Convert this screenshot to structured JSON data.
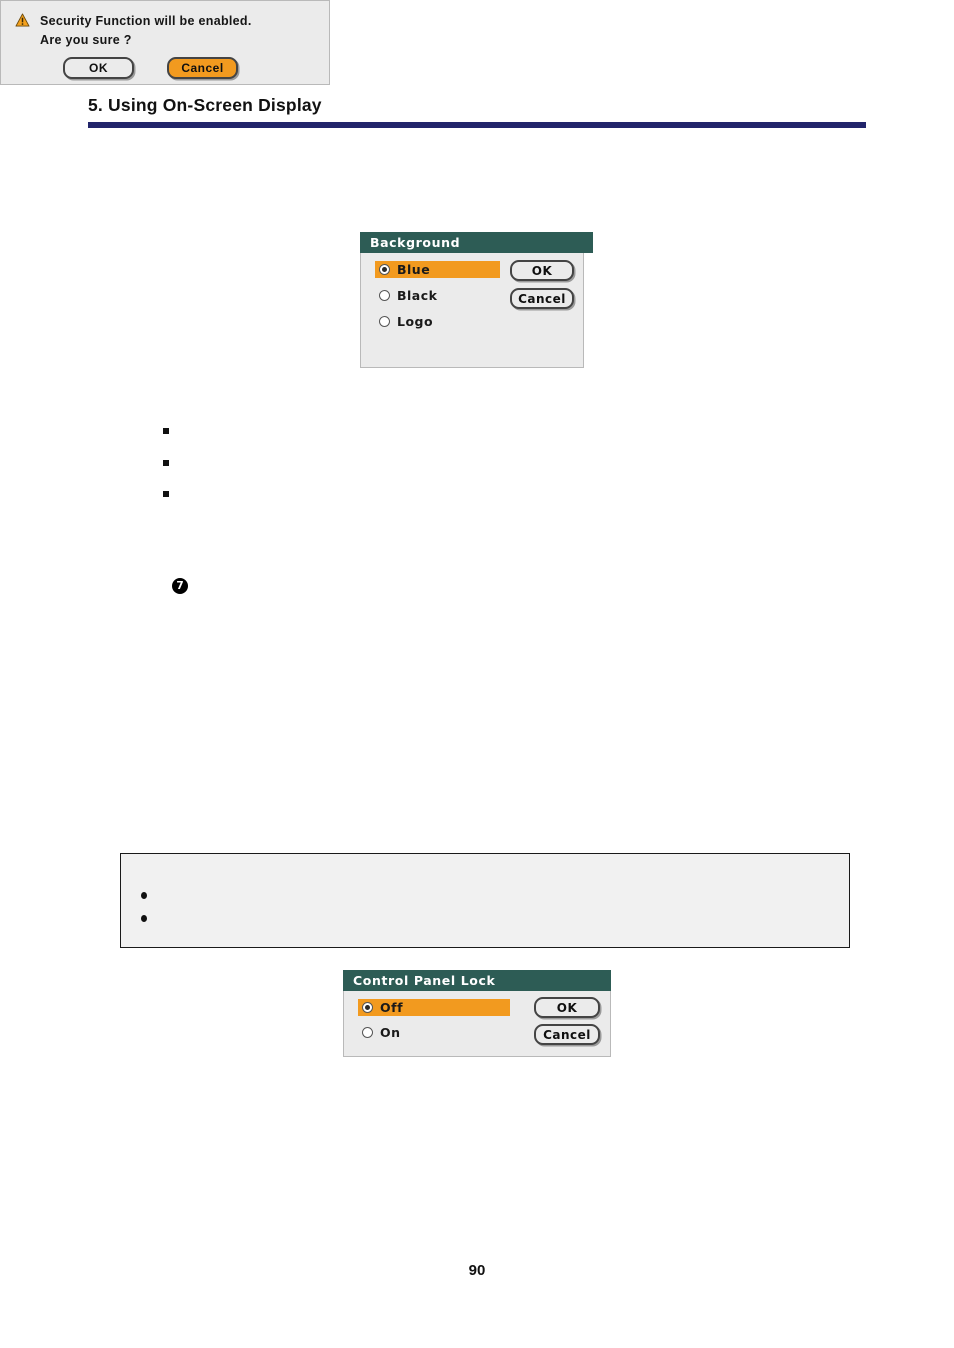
{
  "header": {
    "chapter_title": "5. Using On-Screen Display",
    "rule_color": "#22256b"
  },
  "colors": {
    "osd_titlebar": "#2d5c55",
    "osd_body": "#ebebeb",
    "highlight_orange": "#f29a1f",
    "warning_icon": "#f29a1f",
    "text": "#1a1a1a"
  },
  "dialogs": {
    "background": {
      "title": "Background",
      "options": [
        {
          "label": "Blue",
          "selected": true
        },
        {
          "label": "Black",
          "selected": false
        },
        {
          "label": "Logo",
          "selected": false
        }
      ],
      "buttons": [
        {
          "label": "OK",
          "accent": false
        },
        {
          "label": "Cancel",
          "accent": false
        }
      ]
    },
    "security_confirm": {
      "icon": "warning-triangle-icon",
      "lines": [
        "Security Function will be enabled.",
        "Are you sure ?"
      ],
      "buttons": [
        {
          "label": "OK",
          "accent": false
        },
        {
          "label": "Cancel",
          "accent": true
        }
      ]
    },
    "control_panel_lock": {
      "title": "Control Panel Lock",
      "options": [
        {
          "label": "Off",
          "selected": true
        },
        {
          "label": "On",
          "selected": false
        }
      ],
      "buttons": [
        {
          "label": "OK",
          "accent": false
        },
        {
          "label": "Cancel",
          "accent": false
        }
      ]
    }
  },
  "body": {
    "bullets": [
      "",
      "",
      ""
    ],
    "step_marker": "7",
    "note_bullets": [
      "",
      ""
    ]
  },
  "footer": {
    "page_number": "90"
  }
}
